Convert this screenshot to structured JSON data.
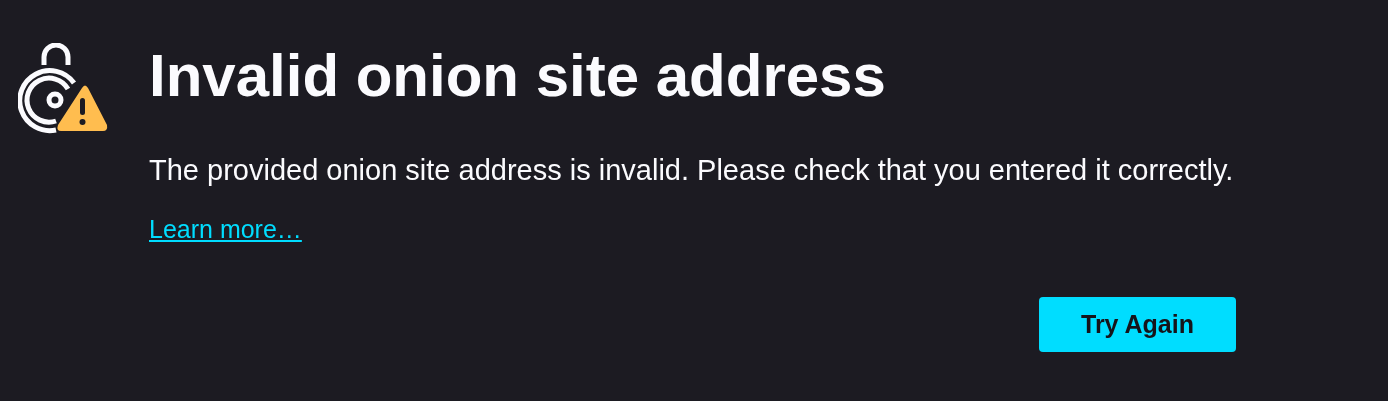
{
  "title": "Invalid onion site address",
  "description": "The provided onion site address is invalid. Please check that you entered it correctly.",
  "link": "Learn more…",
  "button": "Try Again"
}
